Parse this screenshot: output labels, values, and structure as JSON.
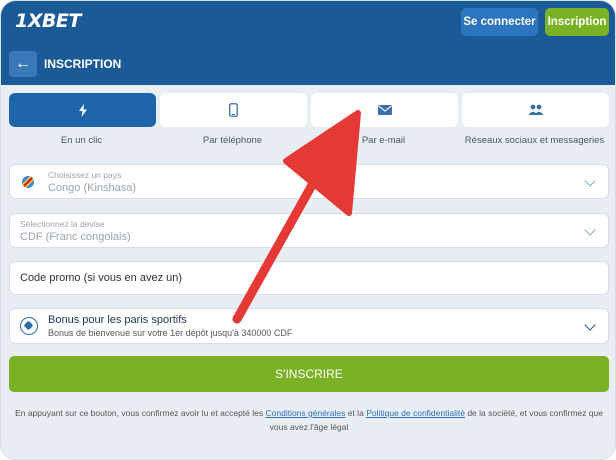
{
  "header": {
    "logo_text": "1XBET",
    "login_label": "Se connecter",
    "register_label": "Inscription"
  },
  "subheader": {
    "title": "INSCRIPTION"
  },
  "tabs": [
    {
      "label": "En un clic",
      "icon": "lightning-icon",
      "active": true
    },
    {
      "label": "Par téléphone",
      "icon": "phone-icon",
      "active": false
    },
    {
      "label": "Par e-mail",
      "icon": "envelope-icon",
      "active": false
    },
    {
      "label": "Réseaux sociaux et messageries",
      "icon": "users-icon",
      "active": false
    }
  ],
  "form": {
    "country": {
      "label": "Choisissez un pays",
      "value": "Congo (Kinshasa)"
    },
    "currency": {
      "label": "Sélectionnez la devise",
      "value": "CDF  (Franc congolais)"
    },
    "promo": {
      "placeholder": "Code promo (si vous en avez un)"
    },
    "bonus": {
      "title": "Bonus pour les paris sportifs",
      "subtitle": "Bonus de bienvenue sur votre 1er dépôt jusqu'à 340000 CDF"
    },
    "submit_label": "S'INSCRIRE"
  },
  "legal": {
    "prefix": "En appuyant sur ce bouton, vous confirmez avoir lu et accepté les",
    "terms_link": "Conditions générales",
    "middle": "et la",
    "privacy_link": "Politique de confidentialité",
    "suffix": "de la société, et vous confirmez que vous avez l'âge légal"
  },
  "colors": {
    "header_bg": "#1a5a96",
    "accent_green": "#7bb225",
    "arrow_red": "#e53935"
  }
}
